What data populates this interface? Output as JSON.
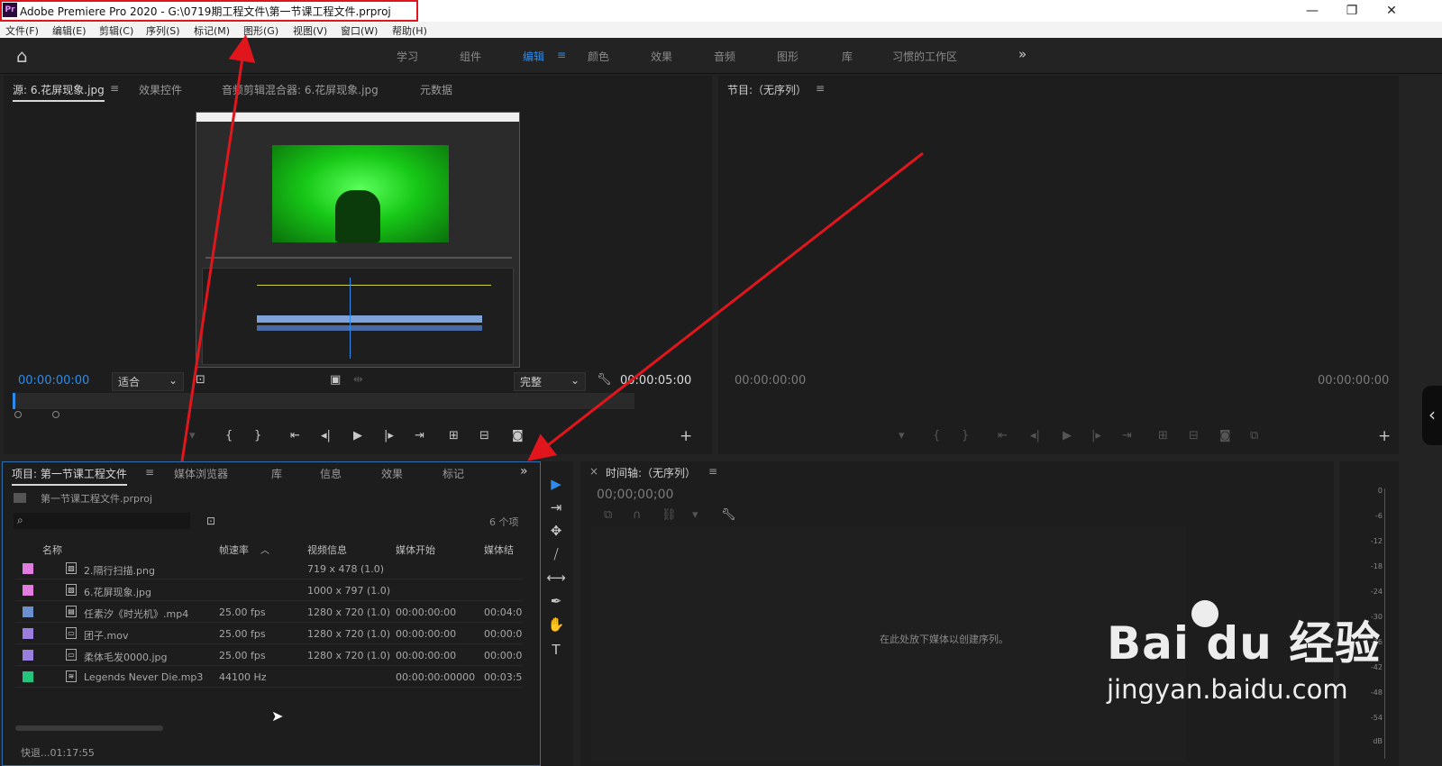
{
  "titlebar": {
    "app_icon": "Pr",
    "title": "Adobe Premiere Pro 2020 - G:\\0719期工程文件\\第一节课工程文件.prproj",
    "minimize": "—",
    "restore": "❐",
    "close": "✕"
  },
  "menu": [
    "文件(F)",
    "编辑(E)",
    "剪辑(C)",
    "序列(S)",
    "标记(M)",
    "图形(G)",
    "视图(V)",
    "窗口(W)",
    "帮助(H)"
  ],
  "workspaces": {
    "home_icon": "⌂",
    "tabs": [
      "学习",
      "组件",
      "编辑",
      "颜色",
      "效果",
      "音频",
      "图形",
      "库",
      "习惯的工作区"
    ],
    "active": "编辑",
    "menu_glyph": "≡",
    "overflow": "»"
  },
  "source_panel": {
    "tabs": [
      "源: 6.花屏现象.jpg",
      "效果控件",
      "音频剪辑混合器: 6.花屏现象.jpg",
      "元数据"
    ],
    "menu_glyph": "≡",
    "timecode_in": "00:00:00:00",
    "fit": "适合",
    "quality": "完整",
    "timecode_out": "00:00:05:00",
    "add_button": "+"
  },
  "program_panel": {
    "title": "节目:（无序列）",
    "menu_glyph": "≡",
    "timecode_left": "00:00:00:00",
    "timecode_right": "00:00:00:00",
    "add_button": "+",
    "collapse_icon": "‹"
  },
  "project_panel": {
    "tabs": [
      "项目: 第一节课工程文件",
      "媒体浏览器",
      "库",
      "信息",
      "效果",
      "标记"
    ],
    "menu_glyph": "≡",
    "overflow": "»",
    "file_name": "第一节课工程文件.prproj",
    "search_icon_glyph": "⌕",
    "item_count": "6 个项",
    "columns": [
      "名称",
      "帧速率",
      "视频信息",
      "媒体开始",
      "媒体结"
    ],
    "rows": [
      {
        "color": "#e27ce0",
        "icon": "▧",
        "name": "2.隔行扫描.png",
        "fps": "",
        "video": "719 x 478 (1.0)",
        "start": "",
        "end": ""
      },
      {
        "color": "#e27ce0",
        "icon": "▧",
        "name": "6.花屏现象.jpg",
        "fps": "",
        "video": "1000 x 797 (1.0)",
        "start": "",
        "end": ""
      },
      {
        "color": "#6b8fcf",
        "icon": "▤",
        "name": "任素汐《时光机》.mp4",
        "fps": "25.00 fps",
        "video": "1280 x 720 (1.0)",
        "start": "00:00:00:00",
        "end": "00:04:0"
      },
      {
        "color": "#9a7fe0",
        "icon": "▭",
        "name": "团子.mov",
        "fps": "25.00 fps",
        "video": "1280 x 720 (1.0)",
        "start": "00:00:00:00",
        "end": "00:00:0"
      },
      {
        "color": "#9a7fe0",
        "icon": "▭",
        "name": "柔体毛发0000.jpg",
        "fps": "25.00 fps",
        "video": "1280 x 720 (1.0)",
        "start": "00:00:00:00",
        "end": "00:00:0"
      },
      {
        "color": "#22c47e",
        "icon": "≋",
        "name": "Legends Never Die.mp3",
        "fps": "44100 Hz",
        "video": "",
        "start": "00:00:00:00000",
        "end": "00:03:5"
      }
    ],
    "footer": "快退...01:17:55"
  },
  "tools": [
    "▶",
    "⇥",
    "✥",
    "⧸",
    "⟷",
    "✒",
    "✋",
    "T"
  ],
  "timeline_panel": {
    "title": "时间轴:（无序列）",
    "close": "×",
    "menu_glyph": "≡",
    "timecode": "00;00;00;00",
    "drop_hint": "在此处放下媒体以创建序列。"
  },
  "audio_meter": {
    "ticks": [
      "0",
      "-6",
      "-12",
      "-18",
      "-24",
      "-30",
      "-36",
      "-42",
      "-48",
      "-54",
      "dB"
    ]
  },
  "watermark": {
    "logo": "Bai du 经验",
    "url": "jingyan.baidu.com"
  },
  "colors": {
    "accent": "#2d8ceb",
    "annotation": "#e0161c"
  }
}
